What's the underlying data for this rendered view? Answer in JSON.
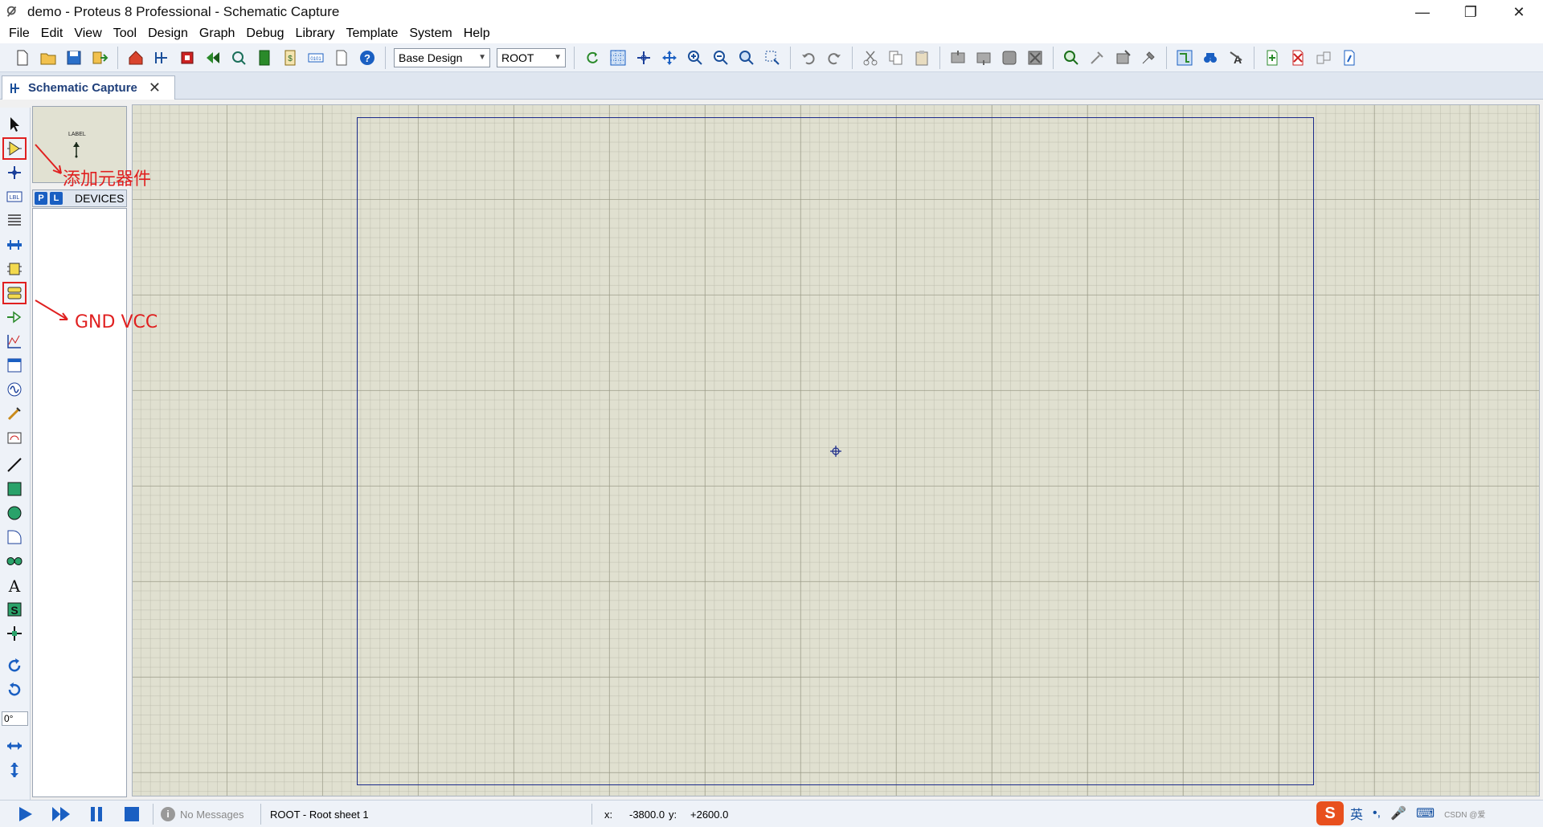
{
  "window": {
    "title": "demo - Proteus 8 Professional - Schematic Capture",
    "min_glyph": "—",
    "restore_glyph": "❐",
    "close_glyph": "✕"
  },
  "menu": [
    "File",
    "Edit",
    "View",
    "Tool",
    "Design",
    "Graph",
    "Debug",
    "Library",
    "Template",
    "System",
    "Help"
  ],
  "toolbar": {
    "design_select": "Base Design",
    "sheet_select": "ROOT"
  },
  "tab": {
    "label": "Schematic Capture",
    "close_glyph": "✕"
  },
  "left_toolbar": {
    "rotation_value": "0°"
  },
  "device_panel": {
    "p_button": "P",
    "l_button": "L",
    "title": "DEVICES",
    "preview_label": "LABEL"
  },
  "annotations": {
    "add_component": "添加元器件",
    "gnd_vcc": "GND VCC"
  },
  "statusbar": {
    "messages": "No Messages",
    "sheet": "ROOT - Root sheet 1",
    "x_label": "x:",
    "x_value": "-3800.0",
    "y_label": "y:",
    "y_value": "+2600.0"
  },
  "ime": {
    "logo": "S",
    "lang": "英",
    "punct": "•,",
    "watermark": "CSDN @爱"
  },
  "colors": {
    "canvas_bg": "#e0e0d0",
    "sheet_border": "#1a2a8a",
    "annotation": "#e02020",
    "accent": "#1a5fc2"
  }
}
